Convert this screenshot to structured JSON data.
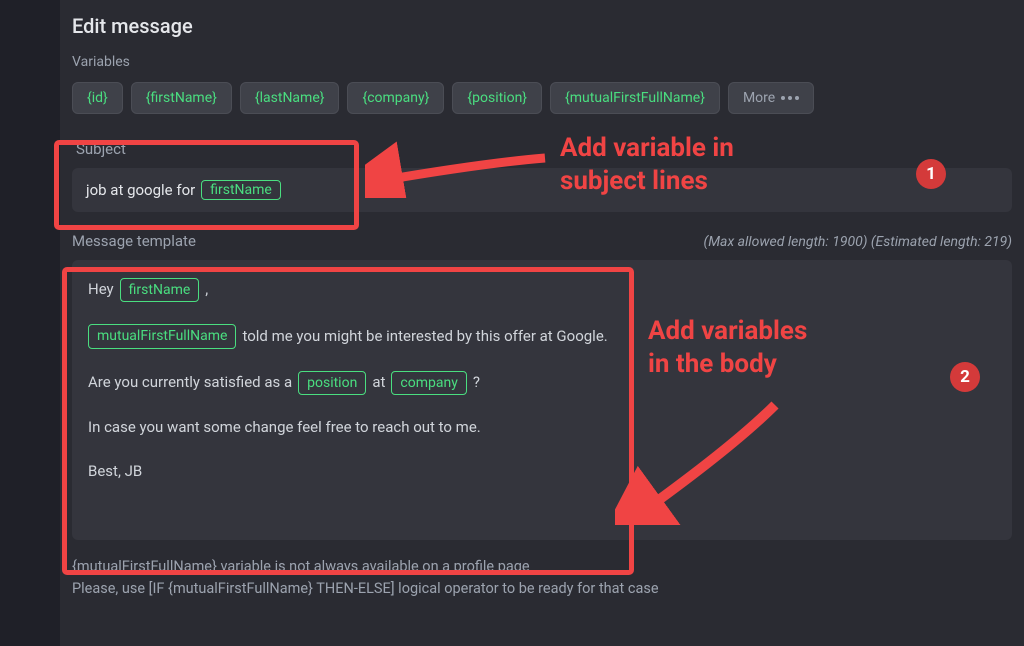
{
  "title": "Edit message",
  "variables_label": "Variables",
  "chips": [
    "{id}",
    "{firstName}",
    "{lastName}",
    "{company}",
    "{position}",
    "{mutualFirstFullName}"
  ],
  "more_label": "More",
  "subject_label": "Subject",
  "subject_prefix": "job at google for",
  "subject_var": "firstName",
  "template_label": "Message template",
  "max_length_text": "(Max allowed length: 1900) (Estimated length: 219)",
  "body": {
    "l1a": "Hey",
    "l1v": "firstName",
    "l1b": ",",
    "l2v": "mutualFirstFullName",
    "l2a": "told me you might be interested by this offer at Google.",
    "l3a": "Are you currently satisfied as a",
    "l3v1": "position",
    "l3b": "at",
    "l3v2": "company",
    "l3c": "?",
    "l4": "In case you want some change feel free to reach out to me.",
    "l5": "Best, JB"
  },
  "footer_l1": "{mutualFirstFullName} variable is not always available on a profile page",
  "footer_l2": "Please, use [IF {mutualFirstFullName} THEN-ELSE] logical operator to be ready for that case",
  "annotations": {
    "text1": "Add variable in\nsubject lines",
    "text2": "Add variables\nin the body",
    "badge1": "1",
    "badge2": "2"
  }
}
